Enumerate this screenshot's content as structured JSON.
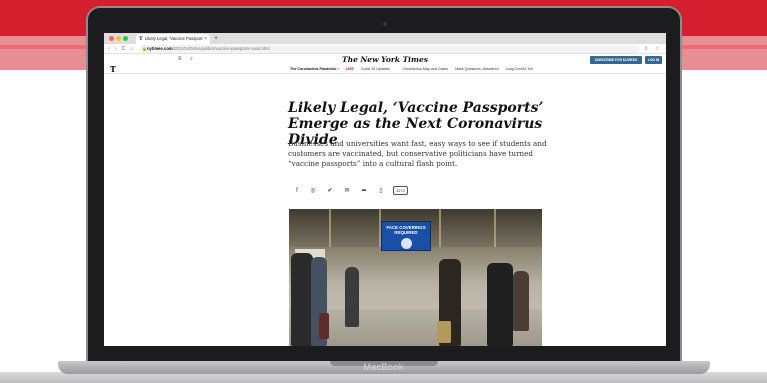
{
  "laptop": {
    "brand": "MacBook"
  },
  "browser": {
    "tab_title": "Likely Legal, 'Vaccine Passport",
    "tab_close": "×",
    "new_tab": "+",
    "url_host": "nytimes.com",
    "url_path": "/2021/04/04/us/politics/vaccine-passports-covid.html",
    "back_icon": "‹",
    "forward_icon": "›",
    "reload_icon": "C",
    "home_icon": "⌂",
    "lock_icon": "🔒",
    "share_icon": "⇪",
    "star_icon": "☆"
  },
  "nyt": {
    "masthead": "The New York Times",
    "t_logo": "T",
    "menu_icon": "≡",
    "search_icon": "⌕",
    "subscribe_label": "SUBSCRIBE FOR $1/WEEK",
    "login_label": "LOG IN",
    "subnav": {
      "pandemic": "The Coronavirus Pandemic ›",
      "live": "LIVE",
      "updates": "Covid-19 Updates",
      "map": "Coronavirus Map and Cases",
      "masks": "Mask Questions, Answered",
      "long_covid": "Long Covid's Toll"
    }
  },
  "article": {
    "headline": "Likely Legal, ‘Vaccine Passports’ Emerge as the Next Coronavirus Divide",
    "dek": "Businesses and universities want fast, easy ways to see if students and customers are vaccinated, but conservative politicians have turned “vaccine passports” into a cultural flash point.",
    "share_icons": {
      "facebook": "f",
      "whatsapp": "◎",
      "twitter": "✔",
      "email": "✉",
      "share": "➦",
      "bookmark": "▯"
    },
    "comment_count": "1272",
    "photo_sign_text": "FACE COVERINGS REQUIRED"
  }
}
